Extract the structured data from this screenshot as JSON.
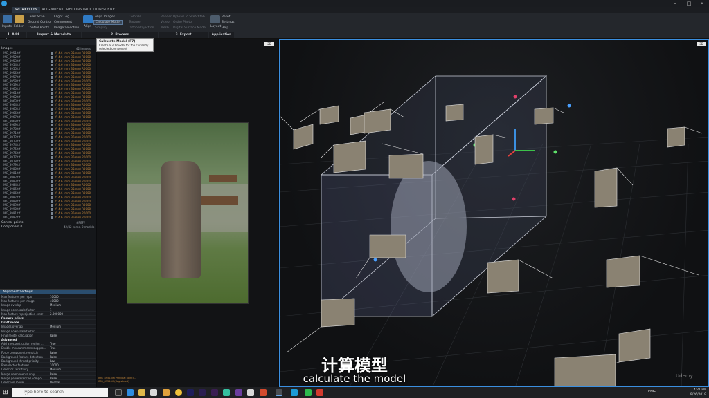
{
  "window": {
    "title": "RealityCapture"
  },
  "tabs": [
    "WORKFLOW",
    "ALIGNMENT",
    "RECONSTRUCTION",
    "SCENE"
  ],
  "ribbon": {
    "import_label": "Inputs",
    "folder_label": "Folder",
    "col2": [
      "Laser Scan",
      "Ground Control",
      "Control Points"
    ],
    "col3": [
      "Flight Log",
      "Component",
      "Image Selection"
    ],
    "align_label": "Align",
    "col5": [
      "Align Images",
      "Calculate Model",
      "Simplify"
    ],
    "col6": [
      "Colorize",
      "Texture",
      "Ortho Projection"
    ],
    "col7": [
      "Render",
      "Video",
      "Mesh"
    ],
    "col8": [
      "Upload To Sketchfab",
      "Ortho Photo",
      "Digital Surface Model"
    ],
    "col9_label": "Layout",
    "col10": [
      "Reset",
      "Settings",
      "Help"
    ],
    "groups": [
      "1. Add Imagery",
      "Import & Metadata",
      "2. Process",
      "3. Export",
      "Application"
    ]
  },
  "tooltip": {
    "title": "Calculate Model (F7)",
    "body": "Create a 3D model for the currently selected component"
  },
  "leftpanel": {
    "root": "Images",
    "count": "42 images",
    "images": [
      "IMG_8951.tif",
      "IMG_8952.tif",
      "IMG_8953.tif",
      "IMG_8954.tif",
      "IMG_8955.tif",
      "IMG_8956.tif",
      "IMG_8957.tif",
      "IMG_8958.tif",
      "IMG_8959.tif",
      "IMG_8960.tif",
      "IMG_8961.tif",
      "IMG_8962.tif",
      "IMG_8963.tif",
      "IMG_8964.tif",
      "IMG_8965.tif",
      "IMG_8966.tif",
      "IMG_8967.tif",
      "IMG_8968.tif",
      "IMG_8969.tif",
      "IMG_8970.tif",
      "IMG_8971.tif",
      "IMG_8972.tif",
      "IMG_8973.tif",
      "IMG_8974.tif",
      "IMG_8975.tif",
      "IMG_8976.tif",
      "IMG_8977.tif",
      "IMG_8978.tif",
      "IMG_8979.tif",
      "IMG_8980.tif",
      "IMG_8981.tif",
      "IMG_8982.tif",
      "IMG_8983.tif",
      "IMG_8984.tif",
      "IMG_8985.tif",
      "IMG_8986.tif",
      "IMG_8987.tif",
      "IMG_8988.tif",
      "IMG_8989.tif",
      "IMG_8990.tif",
      "IMG_8991.tif",
      "IMG_8992.tif"
    ],
    "status": "f: 4.6 (mm 35mm) R0000",
    "control_points": "Control points",
    "component": "Component 0",
    "cp_value": "#REF?",
    "comp_value": "42/42 cams, 0 models"
  },
  "settings": {
    "header": "Alignment Settings",
    "rows": [
      [
        "Max features per mpx",
        "10000"
      ],
      [
        "Max features per image",
        "40000"
      ],
      [
        "Image overlap",
        "Medium"
      ],
      [
        "Image downscale factor",
        "1"
      ],
      [
        "Max feature reprojection error",
        "2.000000"
      ],
      [
        "Camera priors",
        ""
      ],
      [
        "Draft mode",
        ""
      ],
      [
        "Images overlap",
        "Medium"
      ],
      [
        "Image downscale factor",
        "1"
      ],
      [
        "Final model calculation",
        "False"
      ],
      [
        "Advanced",
        ""
      ],
      [
        "Add a reconstruction region ...",
        "True"
      ],
      [
        "Enable measurements sugges...",
        "True"
      ],
      [
        "Force component rematch",
        "False"
      ],
      [
        "Background feature detection",
        "False"
      ],
      [
        "Background thread priority",
        "Low"
      ],
      [
        "Preselector features",
        "10000"
      ],
      [
        "Detector sensitivity",
        "Medium"
      ],
      [
        "Merge components only",
        "False"
      ],
      [
        "Merge georeferenced compo...",
        "False"
      ],
      [
        "Detection model",
        "Normal"
      ]
    ]
  },
  "viewport": {
    "zoom_btn": "2D",
    "zoom_btn3d": "3D"
  },
  "midpanel": {
    "zoom_btn": "2D",
    "footer": "IMG_8952.tif (Principal point) ...\nIMG_8952.tif (Registered)"
  },
  "subtitles": {
    "cn": "计算模型",
    "en": "calculate the model"
  },
  "taskbar": {
    "search_placeholder": "Type here to search",
    "lang": "ENG",
    "time": "4:21 PM",
    "date": "9/26/2019"
  },
  "watermark": "Udemy",
  "colors": {
    "accent": "#3b8fe0",
    "status_orange": "#c7883a"
  }
}
